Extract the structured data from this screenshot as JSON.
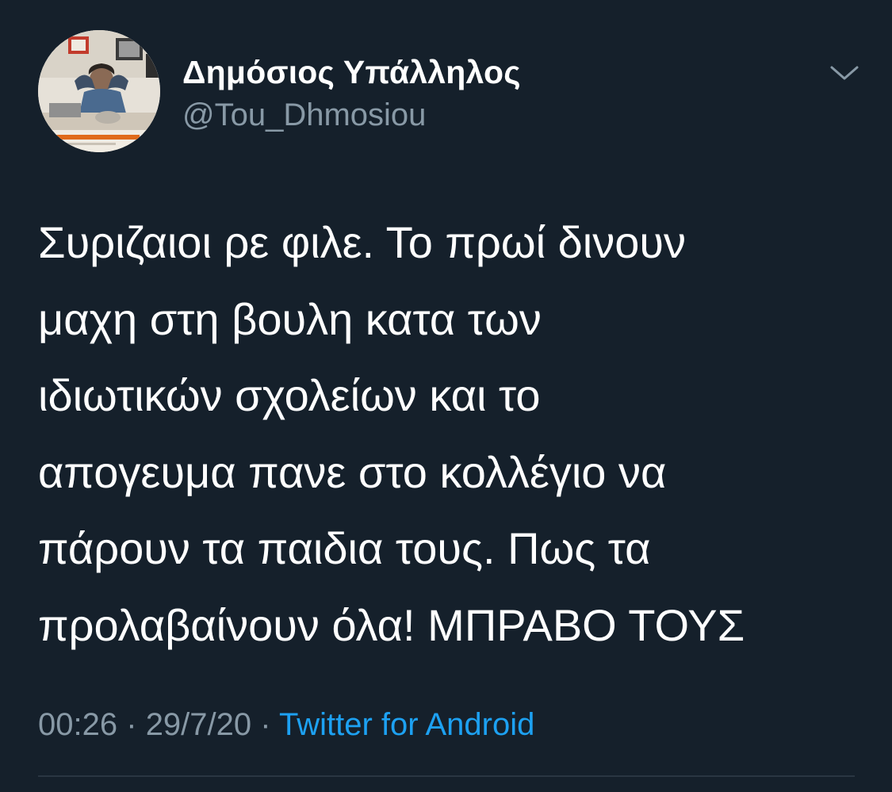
{
  "tweet": {
    "author": {
      "display_name": "Δημόσιος Υπάλληλος",
      "handle": "@Tou_Dhmosiou",
      "avatar_icon": "profile-photo"
    },
    "more_icon": "chevron-down-icon",
    "text": "Συριζαιοι ρε φιλε. Το πρωί δινουν\nμαχη στη βουλη κατα των\nιδιωτικών σχολείων και το\nαπογευμα πανε στο κολλέγιο να\nπάρουν τα παιδια τους. Πως τα\nπρολαβαίνουν όλα! ΜΠΡΑΒΟ ΤΟΥΣ",
    "meta": {
      "time": "00:26",
      "date": "29/7/20",
      "separator": "·",
      "source": "Twitter for Android"
    }
  },
  "colors": {
    "background": "#15202b",
    "primary_text": "#ffffff",
    "secondary_text": "#8899a6",
    "link": "#1da1f2",
    "divider": "#2a3642"
  }
}
